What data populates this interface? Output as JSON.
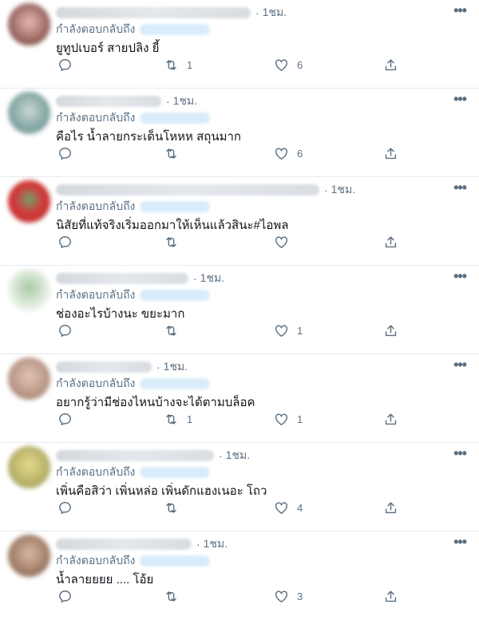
{
  "replying_label": "กำลังตอบกลับถึง",
  "colors": {
    "secondary_text": "#5b7083",
    "divider": "#e6ecf0",
    "mention": "#1da1f2"
  },
  "icons": {
    "reply": "reply-icon",
    "retweet": "retweet-icon",
    "like": "heart-icon",
    "share": "share-icon",
    "more": "more-icon"
  },
  "replies": [
    {
      "time": "1ชม.",
      "text": "ยูทูปเบอร์ สายปลิง ยี้",
      "retweets": "1",
      "likes": "6"
    },
    {
      "time": "1ชม.",
      "text": "คือไร น้ำลายกระเด็นโหหห สถุนมาก",
      "retweets": "",
      "likes": "6"
    },
    {
      "time": "1ชม.",
      "text": "นิสัยที่แท้จริงเริ่มออกมาให้เห็นแล้วสินะ#ไอพล",
      "retweets": "",
      "likes": ""
    },
    {
      "time": "1ชม.",
      "text": "ช่องอะไรบ้างนะ ขยะมาก",
      "retweets": "",
      "likes": "1"
    },
    {
      "time": "1ชม.",
      "text": "อยากรู้ว่ามีช่องไหนบ้างจะได้ตามบล็อค",
      "retweets": "1",
      "likes": "1"
    },
    {
      "time": "1ชม.",
      "text": "เพิ่นคือสิว่า เพิ่นหล่อ เพิ่นดักแฮงเนอะ โถว",
      "retweets": "",
      "likes": "4"
    },
    {
      "time": "1ชม.",
      "text": "น้ำลายยยย .... โอ้ย",
      "retweets": "",
      "likes": "3"
    }
  ]
}
